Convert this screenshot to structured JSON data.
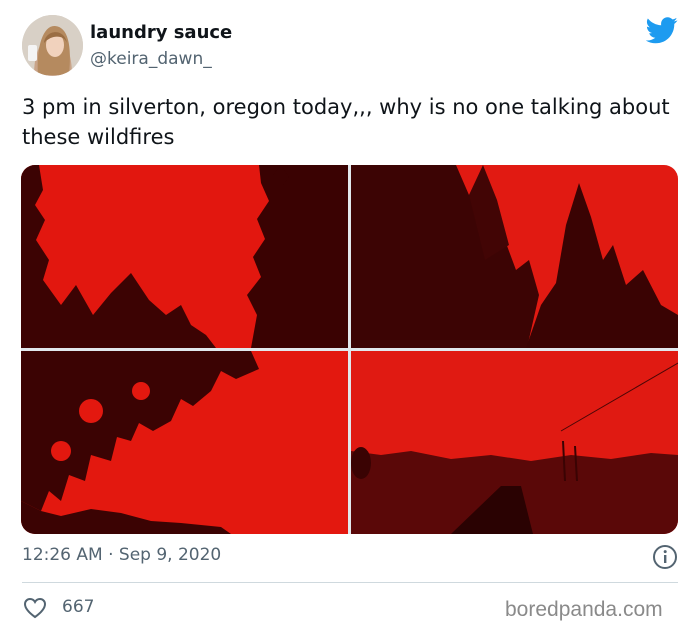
{
  "author": {
    "display_name": "laundry sauce",
    "handle": "@keira_dawn_"
  },
  "tweet": {
    "text": "3 pm in silverton, oregon today,,, why is no one talking about these wildfires",
    "timestamp": "12:26 AM · Sep 9, 2020",
    "likes": "667"
  },
  "icons": {
    "brand": "twitter-bird-icon",
    "info": "info-icon",
    "like": "heart-icon"
  },
  "colors": {
    "twitter_blue": "#1d9bf0",
    "photo_red": "#e01a12",
    "text_secondary": "#536471"
  },
  "watermark": "boredpanda.com"
}
